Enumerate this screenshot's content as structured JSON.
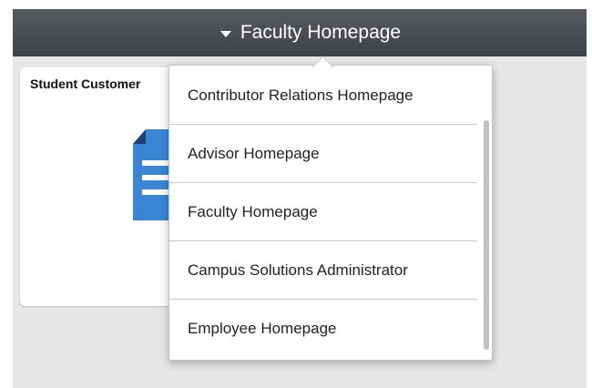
{
  "header": {
    "title": "Faculty Homepage",
    "background_color": "#46494d",
    "caret_icon": "caret-down-icon"
  },
  "tile": {
    "title": "Student Customer",
    "icon": "document-icon",
    "icon_color": "#3a86d4"
  },
  "homepage_menu": {
    "items": [
      {
        "label": "Contributor Relations Homepage"
      },
      {
        "label": "Advisor Homepage"
      },
      {
        "label": "Faculty Homepage"
      },
      {
        "label": "Campus Solutions Administrator"
      },
      {
        "label": "Employee Homepage"
      }
    ]
  }
}
